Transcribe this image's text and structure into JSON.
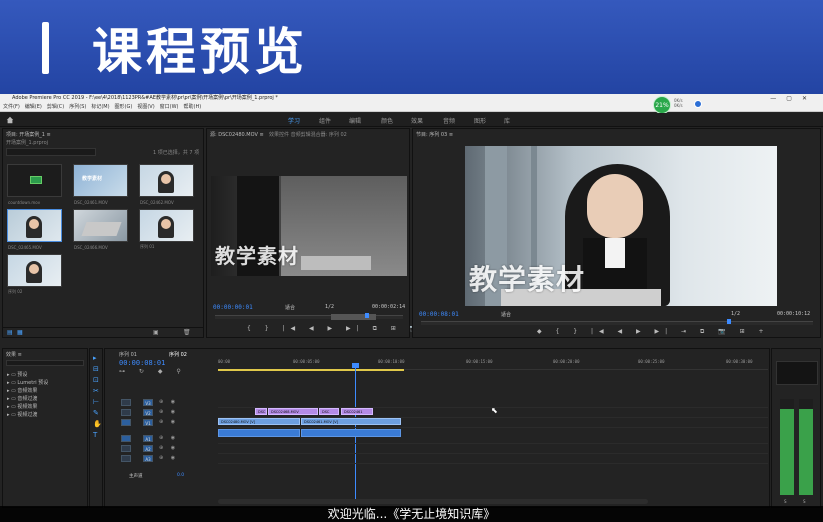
{
  "banner": {
    "title": "课程预览"
  },
  "window": {
    "title": "Adobe Premiere Pro CC 2019 - F:\\ee\\4\\2018\\1123PR&#AE教学素材\\pr\\pr\\案例\\开场案例\\pr\\开场案例_1.prproj *"
  },
  "menu": [
    "文件(F)",
    "编辑(E)",
    "剪辑(C)",
    "序列(S)",
    "标记(M)",
    "图形(G)",
    "视图(V)",
    "窗口(W)",
    "帮助(H)"
  ],
  "system": {
    "cpu_badge": "21%",
    "net_up": "0K/s",
    "net_down": "0K/s"
  },
  "workspaces": [
    {
      "label": "学习",
      "active": true
    },
    {
      "label": "组件",
      "active": false
    },
    {
      "label": "编辑",
      "active": false
    },
    {
      "label": "颜色",
      "active": false
    },
    {
      "label": "效果",
      "active": false
    },
    {
      "label": "音频",
      "active": false
    },
    {
      "label": "图形",
      "active": false
    },
    {
      "label": "库",
      "active": false
    }
  ],
  "project": {
    "tab": "项目: 开场案例_1 ≡",
    "file": "开场案例_1.prproj",
    "selected_info": "1 项已选择，共 7 项",
    "items": [
      {
        "name": "countdown.mov",
        "dur": "1:00:00000"
      },
      {
        "name": "DSC_02461.MOV",
        "dur": "14:15"
      },
      {
        "name": "DSC_02462.MOV",
        "dur": "12:22"
      },
      {
        "name": "DSC_02465.MOV",
        "dur": "2:04"
      },
      {
        "name": "DSC_02466.MOV",
        "dur": "15:24"
      },
      {
        "name": "序列 01",
        "dur": "10:15"
      },
      {
        "name": "序列 02",
        "dur": "2:23"
      }
    ]
  },
  "source": {
    "tab": "源: DSC02480.MOV ≡",
    "tabs_extra": "效果控件   音频剪辑混合器: 序列 02",
    "watermark": "教学素材",
    "timecode": "00:00:00:01",
    "fit": "适合",
    "ratio": "1/2",
    "duration": "00:00:02:14"
  },
  "program": {
    "tab": "节目: 序列 03 ≡",
    "watermark": "教学素材",
    "timecode": "00:00:08:01",
    "fit": "适合",
    "ratio": "1/2",
    "duration": "00:00:10:12"
  },
  "effects": {
    "tab": "效果 ≡",
    "items": [
      "预设",
      "Lumetri 预设",
      "音频效果",
      "音频过渡",
      "视频效果",
      "视频过渡"
    ]
  },
  "timeline": {
    "tabs": [
      "序列 01",
      "序列 02"
    ],
    "timecode": "00:00:08:01",
    "ruler": [
      "00:00",
      "00:00:05:00",
      "00:00:10:00",
      "00:00:15:00",
      "00:00:20:00",
      "00:00:25:00",
      "00:00:30:00"
    ],
    "tracks_v": [
      "V3",
      "V2",
      "V1"
    ],
    "tracks_a": [
      "A1",
      "A2",
      "A3"
    ],
    "master": "主声道",
    "master_val": "0.0",
    "clips_v2": [
      "DSC",
      "DSC02468.MOV",
      "DSC",
      "DSC02461"
    ],
    "clips_v1": [
      "DSC02480.MOV [V]",
      "DSC02461.MOV [V]"
    ]
  },
  "meter": {
    "labels": [
      "S",
      "S"
    ]
  },
  "subtitle": "欢迎光临...《学无止境知识库》"
}
